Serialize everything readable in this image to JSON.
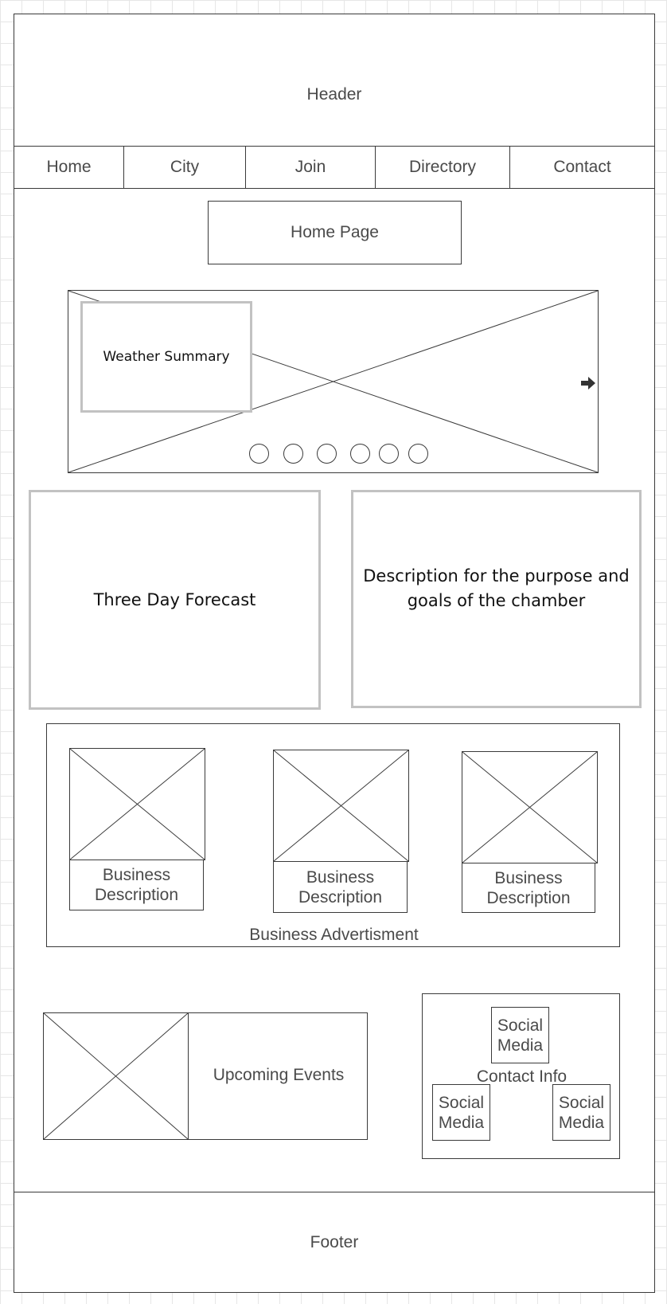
{
  "header": {
    "label": "Header"
  },
  "nav": {
    "items": [
      {
        "label": "Home"
      },
      {
        "label": "City"
      },
      {
        "label": "Join"
      },
      {
        "label": "Directory"
      },
      {
        "label": "Contact"
      }
    ]
  },
  "page_title": {
    "label": "Home Page"
  },
  "hero": {
    "weather_summary": "Weather Summary",
    "next_arrow_icon": "right-arrow-icon",
    "slide_dot_count": 6
  },
  "forecast": {
    "label": "Three Day Forecast"
  },
  "description": {
    "label": "Description for the purpose and goals of the chamber"
  },
  "business": {
    "section_label": "Business Advertisment",
    "cards": [
      {
        "label": "Business Description"
      },
      {
        "label": "Business Description"
      },
      {
        "label": "Business Description"
      }
    ]
  },
  "events": {
    "label": "Upcoming Events"
  },
  "contact": {
    "label": "Contact Info",
    "social": [
      {
        "label": "Social Media"
      },
      {
        "label": "Social Media"
      },
      {
        "label": "Social Media"
      }
    ]
  },
  "footer": {
    "label": "Footer"
  }
}
